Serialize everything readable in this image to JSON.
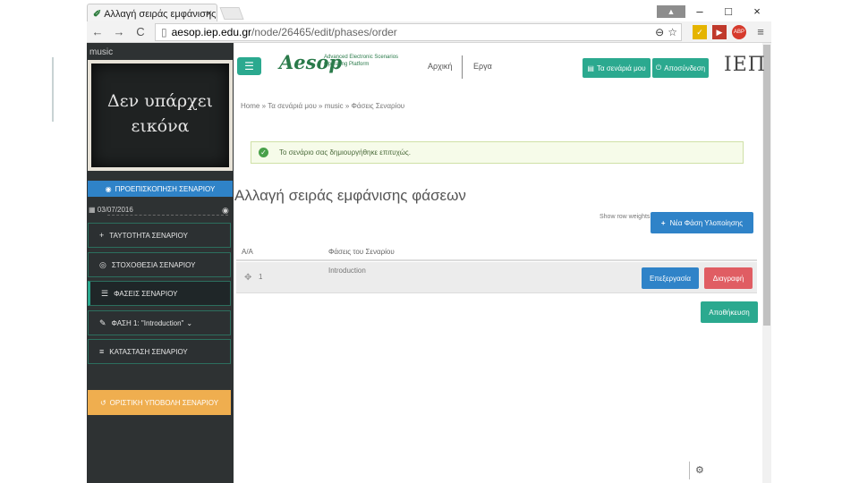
{
  "browser": {
    "tab_title": "Αλλαγή σειράς εμφάνισης",
    "tab_close": "×",
    "window_controls": [
      "–",
      "□",
      "×"
    ],
    "nav": {
      "back": "←",
      "forward": "→",
      "reload": "C"
    },
    "url_host": "aesop.iep.edu.gr",
    "url_path": "/node/26465/edit/phases/order",
    "extensions": [
      {
        "name": "norton-icon",
        "label": "✓",
        "color": "#e5b400"
      },
      {
        "name": "media-icon",
        "label": "▶",
        "color": "#c0392b"
      },
      {
        "name": "adblock-icon",
        "label": "ABP",
        "color": "#d63a2c"
      }
    ],
    "menu": "≡",
    "zoom": "⊖",
    "star": "☆"
  },
  "sidebar": {
    "title": "music",
    "image_text_line1": "Δεν υπάρχει",
    "image_text_line2": "εικόνα",
    "preview_label": "ΠΡΟΕΠΙΣΚΟΠΗΣΗ ΣΕΝΑΡΙΟΥ",
    "date": "03/07/2016",
    "items": [
      {
        "label": "ΤΑΥΤΟΤΗΤΑ ΣΕΝΑΡΙΟΥ",
        "icon": "+"
      },
      {
        "label": "ΣΤΟΧΟΘΕΣΙΑ ΣΕΝΑΡΙΟΥ",
        "icon": "◎"
      },
      {
        "label": "ΦΑΣΕΙΣ ΣΕΝΑΡΙΟΥ",
        "icon": "☰"
      },
      {
        "label": "ΦΑΣΗ 1: \"Introduction\"",
        "icon": "✎"
      },
      {
        "label": "ΚΑΤΑΣΤΑΣΗ ΣΕΝΑΡΙΟΥ",
        "icon": "≡"
      }
    ],
    "submit_label": "ΟΡΙΣΤΙΚΗ ΥΠΟΒΟΛΗ ΣΕΝΑΡΙΟΥ"
  },
  "header": {
    "logo": "Aesop",
    "logo_sub": "Advanced Electronic Scenarios Operating Platform",
    "nav_home": "Αρχική",
    "nav_works": "Εργα",
    "my_scenarios": "Τα σενάριά μου",
    "logout": "Αποσύνδεση",
    "org_logo": "ΙΕΠ"
  },
  "main": {
    "breadcrumb": "Home » Τα σενάριά μου » music » Φάσεις Σεναρίου",
    "alert": "Το σενάριο σας δημιουργήθηκε επιτυχώς.",
    "page_title": "Αλλαγή σειράς εμφάνισης φάσεων",
    "show_weights": "Show row weights",
    "new_phase_label": "Νέα Φάση Υλοποίησης",
    "table": {
      "headers": [
        "Α/Α",
        "Φάσεις του Σεναρίου"
      ],
      "rows": [
        {
          "num": "1",
          "name": "Introduction"
        }
      ]
    },
    "edit_label": "Επεξεργασία",
    "delete_label": "Διαγραφή",
    "save_label": "Αποθήκευση"
  }
}
